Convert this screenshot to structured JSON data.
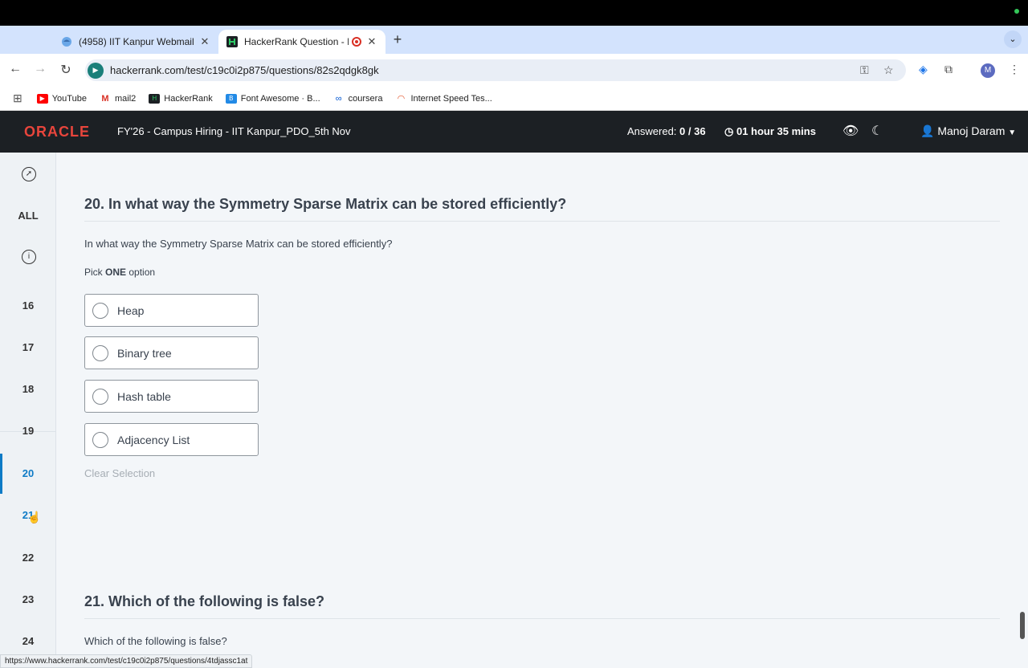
{
  "browser": {
    "tabs": [
      {
        "title": "(4958) IIT Kanpur Webmail :: ",
        "favicon": "webmail-icon"
      },
      {
        "title": "HackerRank Question - In",
        "favicon": "hackerrank-icon",
        "recording": true
      }
    ],
    "url": "hackerrank.com/test/c19c0i2p875/questions/82s2qdgk8gk",
    "profile_initial": "M",
    "bookmarks": [
      {
        "label": "YouTube",
        "icon": "youtube-icon",
        "color": "#ff0000"
      },
      {
        "label": "mail2",
        "icon": "gmail-icon",
        "color": "#d93025"
      },
      {
        "label": "HackerRank",
        "icon": "hackerrank-icon",
        "color": "#1c2024"
      },
      {
        "label": "Font Awesome · B...",
        "icon": "fontawesome-icon",
        "color": "#228ae6"
      },
      {
        "label": "coursera",
        "icon": "coursera-icon",
        "color": "#0056d2"
      },
      {
        "label": "Internet Speed Tes...",
        "icon": "speedtest-icon",
        "color": "#e4572e"
      }
    ],
    "status_url": "https://www.hackerrank.com/test/c19c0i2p875/questions/4tdjassc1at"
  },
  "header": {
    "logo": "ORACLE",
    "test_title": "FY'26 - Campus Hiring - IIT Kanpur_PDO_5th Nov",
    "answered_label": "Answered:",
    "answered_value": "0 / 36",
    "timer": "01 hour 35 mins",
    "user_name": "Manoj Daram"
  },
  "sidebar": {
    "all_label": "ALL",
    "questions": [
      "16",
      "17",
      "18",
      "19",
      "20",
      "21",
      "22",
      "23",
      "24"
    ],
    "active": "20"
  },
  "question": {
    "title": "20. In what way the Symmetry Sparse Matrix can be stored efficiently?",
    "text": "In what way the Symmetry Sparse Matrix can be stored efficiently?",
    "pick_prefix": "Pick",
    "pick_bold": "ONE",
    "pick_suffix": "option",
    "options": [
      "Heap",
      "Binary tree",
      "Hash table",
      "Adjacency List"
    ],
    "clear_label": "Clear Selection"
  },
  "next_question": {
    "title": "21. Which of the following is false?",
    "text": "Which of the following is false?"
  },
  "colors": {
    "header_bg": "#1c2024",
    "oracle_red": "#e8453c",
    "accent_blue": "#0e7bc6"
  }
}
